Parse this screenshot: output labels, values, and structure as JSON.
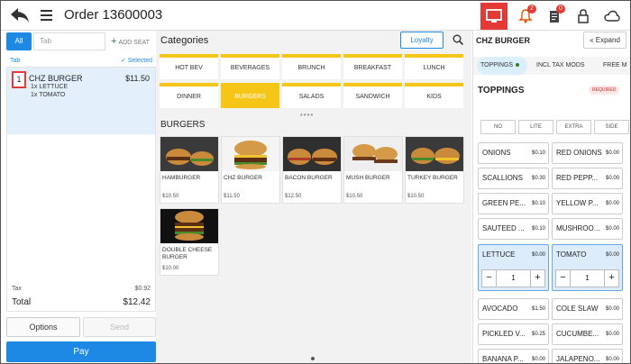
{
  "header": {
    "title": "Order 13600003",
    "notification_count": "2",
    "orders_count": "0"
  },
  "left": {
    "tab_all": "All",
    "tab_placeholder": "Tab",
    "add_seat": "ADD SEAT",
    "tab_label": "Tab",
    "selected_label": "Selected",
    "order_item": {
      "qty": "1",
      "name": "CHZ BURGER",
      "price": "$11.50",
      "modifiers": [
        "1x LETTUCE",
        "1x TOMATO"
      ]
    },
    "tax_label": "Tax",
    "tax_value": "$0.92",
    "total_label": "Total",
    "total_value": "$12.42",
    "options_label": "Options",
    "send_label": "Send",
    "pay_label": "Pay"
  },
  "middle": {
    "categories_title": "Categories",
    "loyalty_label": "Loyalty",
    "categories": [
      "HOT BEV",
      "BEVERAGES",
      "BRUNCH",
      "BREAKFAST",
      "LUNCH",
      "DINNER",
      "BURGERS",
      "SALADS",
      "SANDWICH",
      "KIDS"
    ],
    "selected_category": "BURGERS",
    "section_title": "BURGERS",
    "products": [
      {
        "name": "HAMBURGER",
        "price": "$10.50"
      },
      {
        "name": "CHZ BURGER",
        "price": "$11.50"
      },
      {
        "name": "BACON BURGER",
        "price": "$12.50"
      },
      {
        "name": "MUSH BURGER",
        "price": "$10.50"
      },
      {
        "name": "TURKEY BURGER",
        "price": "$10.50"
      },
      {
        "name": "DOUBLE CHEESE BURGER",
        "price": "$10.00"
      }
    ]
  },
  "right": {
    "title": "CHZ BURGER",
    "expand_label": "Expand",
    "tabs": [
      "TOPPINGS",
      "INCL TAX MODS",
      "FREE M"
    ],
    "section_title": "TOPPINGS",
    "required_label": "REQUIRED",
    "options": [
      "NO",
      "LITE",
      "EXTRA",
      "SIDE"
    ],
    "toppings": [
      {
        "name": "ONIONS",
        "price": "$0.10"
      },
      {
        "name": "RED ONIONS",
        "price": "$0.00"
      },
      {
        "name": "SCALLIONS",
        "price": "$0.30"
      },
      {
        "name": "RED PEPP...",
        "price": "$0.00"
      },
      {
        "name": "GREEN PE...",
        "price": "$0.10"
      },
      {
        "name": "YELLOW P...",
        "price": "$0.00"
      },
      {
        "name": "SAUTEED ...",
        "price": "$0.10"
      },
      {
        "name": "MUSHROO...",
        "price": "$0.00"
      },
      {
        "name": "LETTUCE",
        "price": "$0.00",
        "qty": "1"
      },
      {
        "name": "TOMATO",
        "price": "$0.00",
        "qty": "1"
      },
      {
        "name": "AVOCADO",
        "price": "$1.50"
      },
      {
        "name": "COLE SLAW",
        "price": "$0.00"
      },
      {
        "name": "PICKLED V...",
        "price": "$0.25"
      },
      {
        "name": "CUCUMBE...",
        "price": "$0.00"
      },
      {
        "name": "BANANA P...",
        "price": "$0.00"
      },
      {
        "name": "JALAPENO...",
        "price": "$0.00"
      }
    ],
    "minus": "−",
    "plus": "+"
  },
  "colors": {
    "accent_blue": "#1e88e5",
    "category_yellow": "#f5c518",
    "red": "#e53935"
  }
}
